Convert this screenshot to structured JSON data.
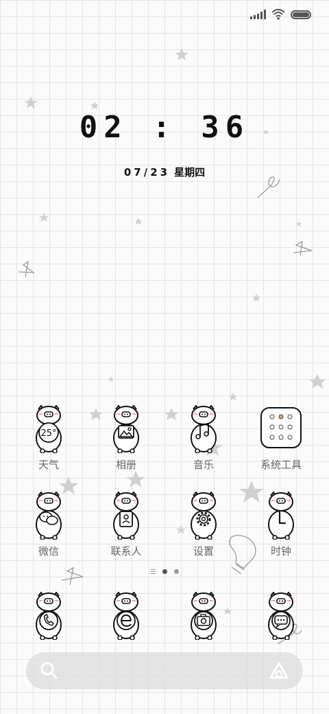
{
  "clock": {
    "time": "02 : 36",
    "date": "07/23",
    "weekday": "星期四"
  },
  "status_bar": {
    "icons": [
      "signal-icon",
      "wifi-icon",
      "battery-icon"
    ],
    "battery_level": 1.0
  },
  "apps_row1": [
    {
      "label": "天气",
      "icon": "weather-icon",
      "badge": "25°"
    },
    {
      "label": "相册",
      "icon": "gallery-icon"
    },
    {
      "label": "音乐",
      "icon": "music-icon"
    },
    {
      "label": "系统工具",
      "icon": "system-tools-folder-icon"
    }
  ],
  "apps_row2": [
    {
      "label": "微信",
      "icon": "wechat-icon"
    },
    {
      "label": "联系人",
      "icon": "contacts-icon"
    },
    {
      "label": "设置",
      "icon": "settings-icon"
    },
    {
      "label": "时钟",
      "icon": "clock-icon"
    }
  ],
  "dock": [
    {
      "icon": "phone-icon"
    },
    {
      "icon": "browser-icon"
    },
    {
      "icon": "camera-icon"
    },
    {
      "icon": "messages-icon"
    }
  ],
  "page_indicator": {
    "pages": 2,
    "current": 1
  },
  "search_bar": {
    "icons": [
      "search-icon",
      "assistant-icon"
    ]
  },
  "colors": {
    "background": "#fbfbfb",
    "grid": "#e4e4e4",
    "ink": "#111111",
    "label": "#666666",
    "search_bar": "#dcdcdc"
  }
}
